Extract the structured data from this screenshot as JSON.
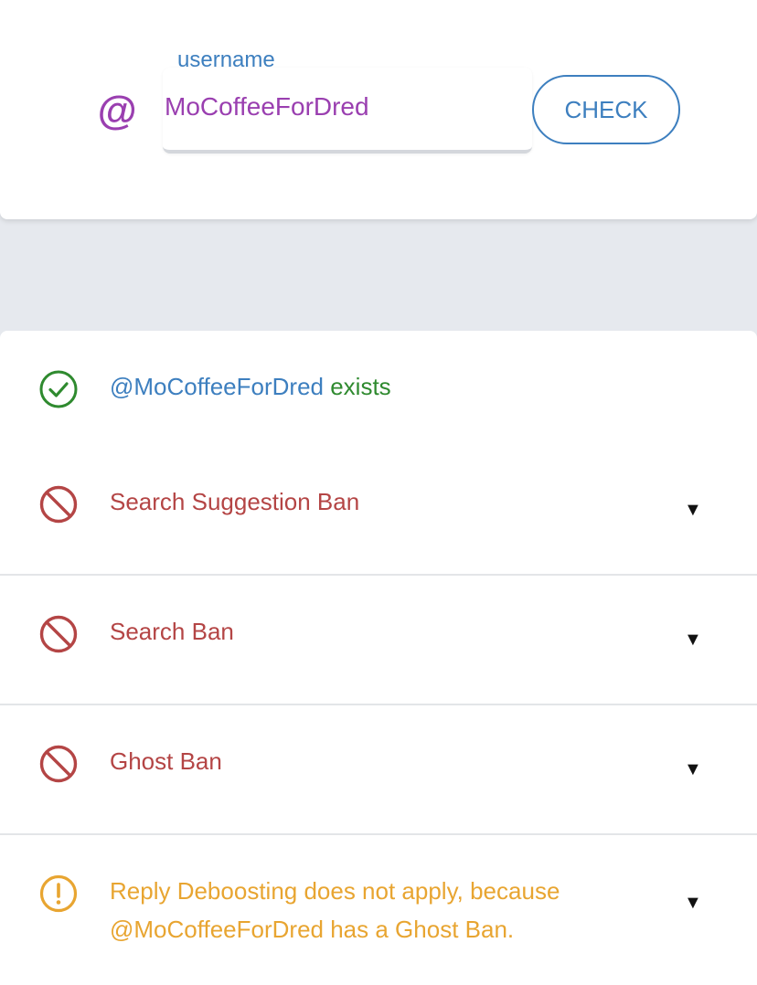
{
  "colors": {
    "accent_blue": "#3d7fbf",
    "username_purple": "#9a3fb0",
    "success_green": "#2f8a2f",
    "ban_red": "#b44545",
    "warning_orange": "#e8a531",
    "arrow": "#111111"
  },
  "form": {
    "at_symbol": "@",
    "username_label": "username",
    "username_value": "MoCoffeeForDred",
    "check_label": "CHECK"
  },
  "results": {
    "exists": {
      "icon": "check-circle-icon",
      "username": "@MoCoffeeForDred",
      "status": " exists"
    },
    "search_suggestion_ban": {
      "icon": "prohibited-icon",
      "label": "Search Suggestion Ban",
      "arrow": "▼"
    },
    "search_ban": {
      "icon": "prohibited-icon",
      "label": "Search Ban",
      "arrow": "▼"
    },
    "ghost_ban": {
      "icon": "prohibited-icon",
      "label": "Ghost Ban",
      "arrow": "▼"
    },
    "reply_deboosting": {
      "icon": "warning-circle-icon",
      "line1": "Reply Deboosting does not apply, because",
      "line2": "@MoCoffeeForDred has a Ghost Ban.",
      "arrow": "▼"
    }
  }
}
